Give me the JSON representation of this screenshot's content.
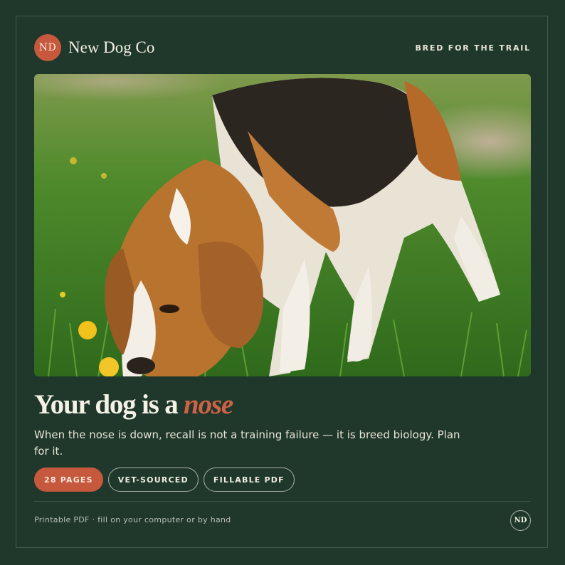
{
  "brand": {
    "initials": "ND",
    "name": "New Dog Co",
    "tagline": "BRED FOR THE TRAIL"
  },
  "hero": {
    "image": "beagle-sniffing-grass-photo"
  },
  "headline": {
    "lead": "Your dog is a ",
    "accent": "nose"
  },
  "subhead": "When the nose is down, recall is not a training failure — it is breed biology. Plan for it.",
  "chips": [
    {
      "label": "28 PAGES"
    },
    {
      "label": "VET-SOURCED"
    },
    {
      "label": "FILLABLE PDF"
    }
  ],
  "footer": {
    "note": "Printable PDF · fill on your computer or by hand",
    "badge": "ND"
  },
  "colors": {
    "background": "#1f382b",
    "accent": "#c6593d",
    "text": "#f1ede3"
  }
}
